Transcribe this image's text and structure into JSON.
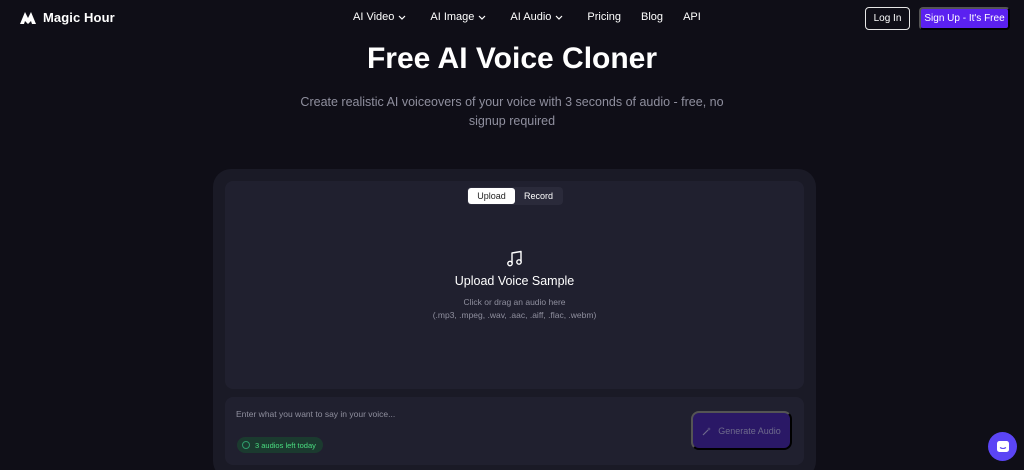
{
  "brand": {
    "name": "Magic Hour",
    "logo_icon": "magic-hour-logo-icon"
  },
  "nav": {
    "items": [
      {
        "label": "AI Video",
        "dropdown": true
      },
      {
        "label": "AI Image",
        "dropdown": true
      },
      {
        "label": "AI Audio",
        "dropdown": true
      },
      {
        "label": "Pricing",
        "dropdown": false
      },
      {
        "label": "Blog",
        "dropdown": false
      },
      {
        "label": "API",
        "dropdown": false
      }
    ],
    "login_label": "Log In",
    "signup_label": "Sign Up  - It's Free"
  },
  "hero": {
    "title": "Free AI Voice Cloner",
    "subtitle": "Create realistic AI voiceovers of your voice with 3 seconds of audio - free, no signup required"
  },
  "uploader": {
    "tabs": [
      {
        "label": "Upload",
        "active": true
      },
      {
        "label": "Record",
        "active": false
      }
    ],
    "icon": "music-note-icon",
    "title": "Upload Voice Sample",
    "hint": "Click or drag an audio here",
    "formats": "(.mp3, .mpeg, .wav, .aac, .aiff, .flac, .webm)"
  },
  "composer": {
    "placeholder": "Enter what you want to say in your voice...",
    "value": "",
    "quota_text": "3 audios left today",
    "generate_label": "Generate Audio",
    "generate_icon": "magic-wand-icon"
  },
  "colors": {
    "background": "#0f0e17",
    "card": "#1a1a26",
    "panel": "#20202f",
    "accent": "#5b21f0",
    "generate_disabled": "#2a1866",
    "quota_green": "#4ade80",
    "chat_bubble": "#5b45f5"
  },
  "support": {
    "icon": "chat-support-icon"
  }
}
